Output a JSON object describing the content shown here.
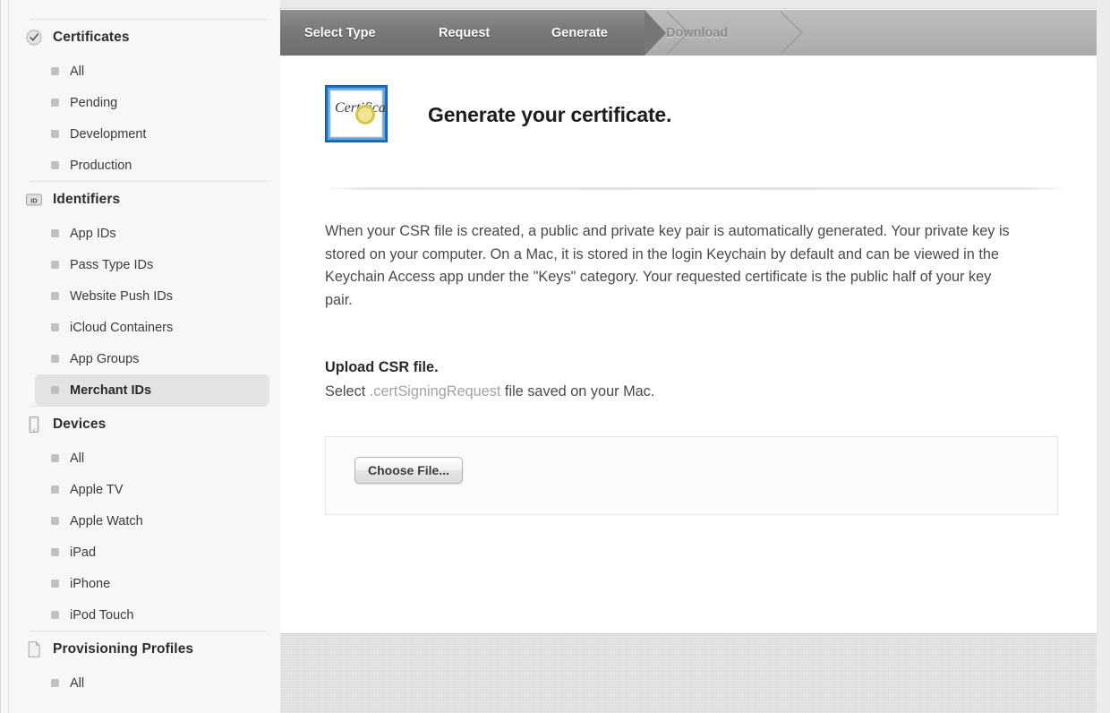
{
  "breadcrumb": {
    "steps": [
      {
        "label": "Select Type",
        "state": "done"
      },
      {
        "label": "Request",
        "state": "done"
      },
      {
        "label": "Generate",
        "state": "current"
      },
      {
        "label": "Download",
        "state": "upcoming"
      }
    ]
  },
  "sidebar": {
    "groups": [
      {
        "title": "Certificates",
        "icon": "certificate-badge-icon",
        "items": [
          {
            "label": "All",
            "selected": false
          },
          {
            "label": "Pending",
            "selected": false
          },
          {
            "label": "Development",
            "selected": false
          },
          {
            "label": "Production",
            "selected": false
          }
        ]
      },
      {
        "title": "Identifiers",
        "icon": "id-badge-icon",
        "items": [
          {
            "label": "App IDs",
            "selected": false
          },
          {
            "label": "Pass Type IDs",
            "selected": false
          },
          {
            "label": "Website Push IDs",
            "selected": false
          },
          {
            "label": "iCloud Containers",
            "selected": false
          },
          {
            "label": "App Groups",
            "selected": false
          },
          {
            "label": "Merchant IDs",
            "selected": true
          }
        ]
      },
      {
        "title": "Devices",
        "icon": "device-phone-icon",
        "items": [
          {
            "label": "All",
            "selected": false
          },
          {
            "label": "Apple TV",
            "selected": false
          },
          {
            "label": "Apple Watch",
            "selected": false
          },
          {
            "label": "iPad",
            "selected": false
          },
          {
            "label": "iPhone",
            "selected": false
          },
          {
            "label": "iPod Touch",
            "selected": false
          }
        ]
      },
      {
        "title": "Provisioning Profiles",
        "icon": "document-page-icon",
        "items": [
          {
            "label": "All",
            "selected": false
          }
        ]
      }
    ]
  },
  "main": {
    "icon": "certificate-document-icon",
    "icon_word": "Certificate",
    "title": "Generate your certificate.",
    "intro": "When your CSR file is created, a public and private key pair is automatically generated. Your private key is stored on your computer. On a Mac, it is stored in the login Keychain by default and can be viewed in the Keychain Access app under the \"Keys\" category. Your requested certificate is the public half of your key pair.",
    "upload_title": "Upload CSR file.",
    "upload_sub_before": "Select ",
    "upload_sub_highlight": ".certSigningRequest",
    "upload_sub_after": " file saved on your Mac.",
    "choose_file_label": "Choose File..."
  },
  "colors": {
    "breadcrumb_active": "#777777",
    "breadcrumb_inactive_text": "#8a8a8a",
    "sidebar_bg": "#f7f7f7",
    "selected_item_bg": "#e3e3e3",
    "muted_text": "#a3a3a3",
    "cert_border_blue": "#1f6fbf",
    "cert_seal_gold": "#e6d46a"
  }
}
